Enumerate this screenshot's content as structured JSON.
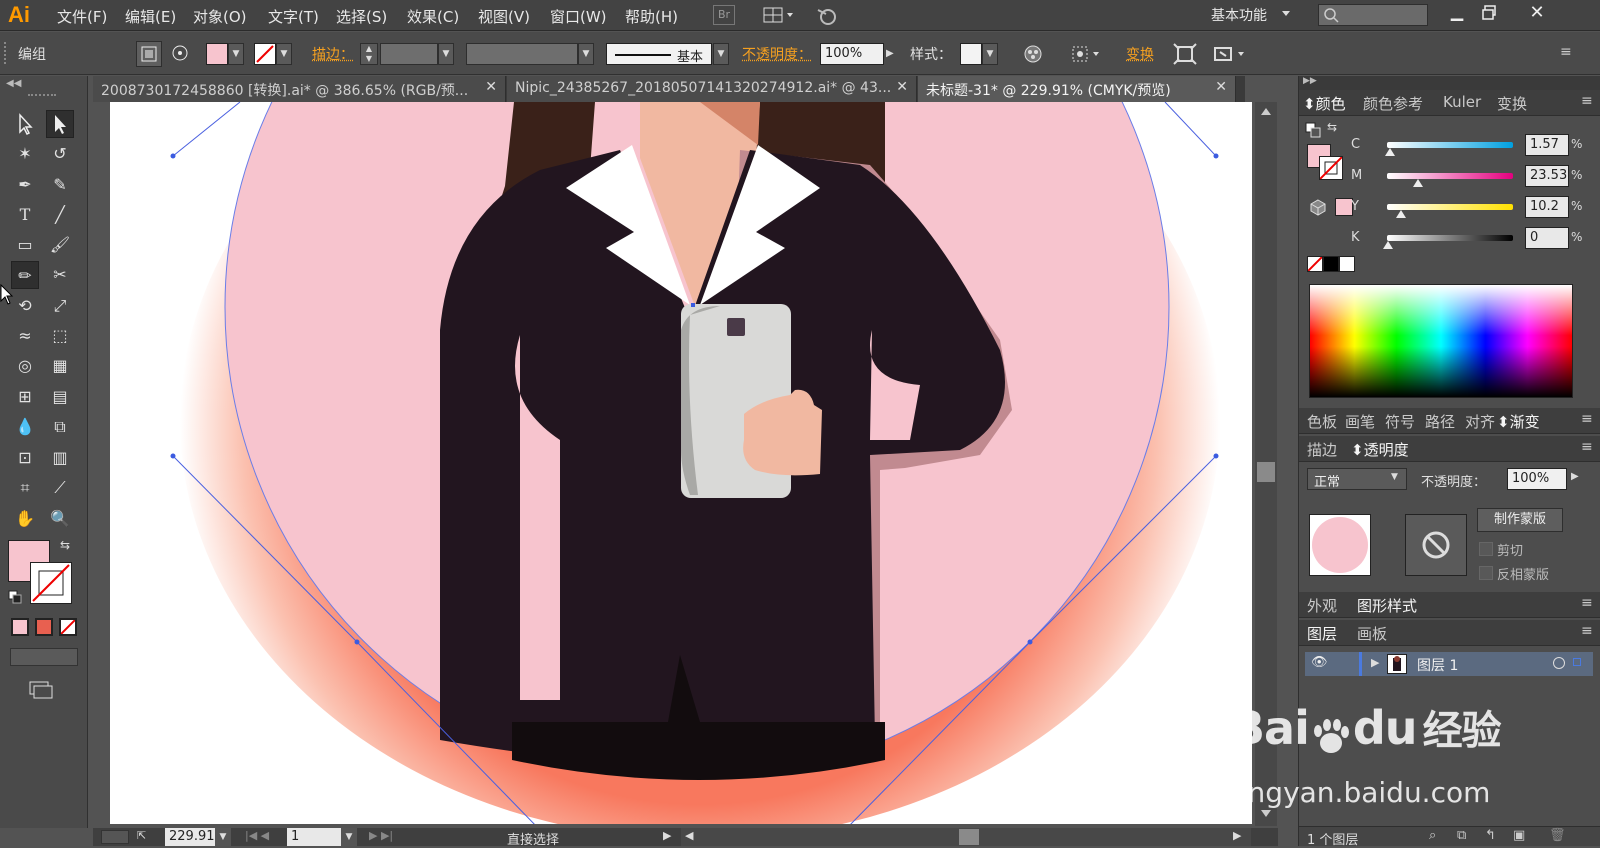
{
  "app": {
    "logo": "Ai",
    "accent": "#ff9a00"
  },
  "menu": [
    "文件(F)",
    "编辑(E)",
    "对象(O)",
    "文字(T)",
    "选择(S)",
    "效果(C)",
    "视图(V)",
    "窗口(W)",
    "帮助(H)"
  ],
  "menubar": {
    "br_button": "Br",
    "workspace": "基本功能"
  },
  "control": {
    "selection_label": "编组",
    "stroke_label": "描边：",
    "stroke_style": "基本",
    "opacity_label": "不透明度：",
    "opacity_value": "100%",
    "style_label": "样式：",
    "transform_label": "变换"
  },
  "tabs": [
    {
      "title": "2008730172458860 [转换].ai* @ 386.65% (RGB/预...",
      "active": false
    },
    {
      "title": "Nipic_24385267_20180507141320274912.ai* @ 43...",
      "active": false
    },
    {
      "title": "未标题-31* @ 229.91% (CMYK/预览)",
      "active": true
    }
  ],
  "status": {
    "zoom": "229.91",
    "artboard": "1",
    "tool_mode": "直接选择"
  },
  "panels": {
    "color_tabs": [
      "颜色",
      "颜色参考",
      "Kuler",
      "变换"
    ],
    "channels": [
      {
        "label": "C",
        "value": "1.57",
        "fraction": 0.0157,
        "gradient": "linear-gradient(to right,#ffffff,#00a0e0)"
      },
      {
        "label": "M",
        "value": "23.53",
        "fraction": 0.2353,
        "gradient": "linear-gradient(to right,#ffffff,#e4007f)"
      },
      {
        "label": "Y",
        "value": "10.2",
        "fraction": 0.102,
        "gradient": "linear-gradient(to right,#ffffff,#ffe100)"
      },
      {
        "label": "K",
        "value": "0",
        "fraction": 0.0,
        "gradient": "linear-gradient(to right,#ffffff,#000000)"
      }
    ],
    "percent": "%",
    "fill_color": "#f7c4ce",
    "second_tabs": [
      "色板",
      "画笔",
      "符号",
      "路径",
      "对齐",
      "渐变"
    ],
    "transparency_tabs": [
      "描边",
      "透明度"
    ],
    "blend_mode": "正常",
    "opacity_label": "不透明度：",
    "opacity_value": "100%",
    "make_mask": "制作蒙版",
    "clip": "剪切",
    "invert_mask": "反相蒙版",
    "appearance_tabs": [
      "外观",
      "图形样式"
    ],
    "layer_tabs": [
      "图层",
      "画板"
    ],
    "layer_name": "图层 1",
    "layer_count": "1 个图层"
  },
  "watermark": {
    "brand": "Bai",
    "brand2": "du",
    "jingyan": "经验",
    "url": "jingyan.baidu.com"
  }
}
